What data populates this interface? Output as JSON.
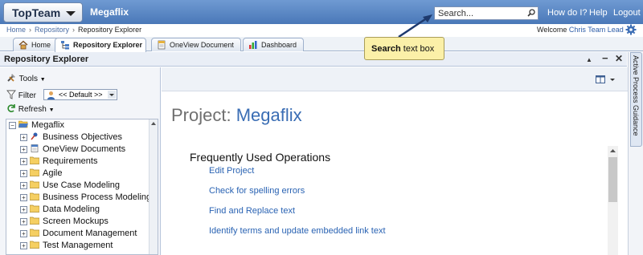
{
  "app": {
    "name": "TopTeam",
    "product": "Megaflix"
  },
  "search": {
    "placeholder": "Search..."
  },
  "topnav": {
    "how": "How do I?",
    "help": "Help",
    "logout": "Logout"
  },
  "breadcrumb": {
    "home": "Home",
    "repo": "Repository",
    "current": "Repository Explorer"
  },
  "welcome": {
    "label": "Welcome",
    "user": "Chris Team Lead"
  },
  "tabs": [
    {
      "label": "Home"
    },
    {
      "label": "Repository Explorer"
    },
    {
      "label": "OneView Document"
    },
    {
      "label": "Dashboard"
    }
  ],
  "explorer": {
    "title": "Repository Explorer"
  },
  "vertical_tab": {
    "label": "Active Process Guidance"
  },
  "left": {
    "tools": "Tools",
    "filter": "Filter",
    "filter_value": "<< Default >>",
    "refresh": "Refresh",
    "tree": [
      {
        "label": "Megaflix",
        "pm": "−"
      },
      {
        "label": "Business Objectives",
        "pm": "+"
      },
      {
        "label": "OneView Documents",
        "pm": "+"
      },
      {
        "label": "Requirements",
        "pm": "+"
      },
      {
        "label": "Agile",
        "pm": "+"
      },
      {
        "label": "Use Case Modeling",
        "pm": "+"
      },
      {
        "label": "Business Process Modeling",
        "pm": "+"
      },
      {
        "label": "Data Modeling",
        "pm": "+"
      },
      {
        "label": "Screen Mockups",
        "pm": "+"
      },
      {
        "label": "Document Management",
        "pm": "+"
      },
      {
        "label": "Test Management",
        "pm": "+"
      }
    ]
  },
  "main": {
    "project_label": "Project:",
    "project_name": "Megaflix",
    "section": "Frequently Used Operations",
    "operations": [
      "Edit Project",
      "Check for spelling errors",
      "Find and Replace text",
      "Identify terms and update embedded link text"
    ]
  },
  "callout": {
    "bold": "Search",
    "rest": "text box"
  },
  "colors": {
    "topbar": "#4a78b8",
    "link": "#2a63b3",
    "callout": "#fbf0a8"
  }
}
